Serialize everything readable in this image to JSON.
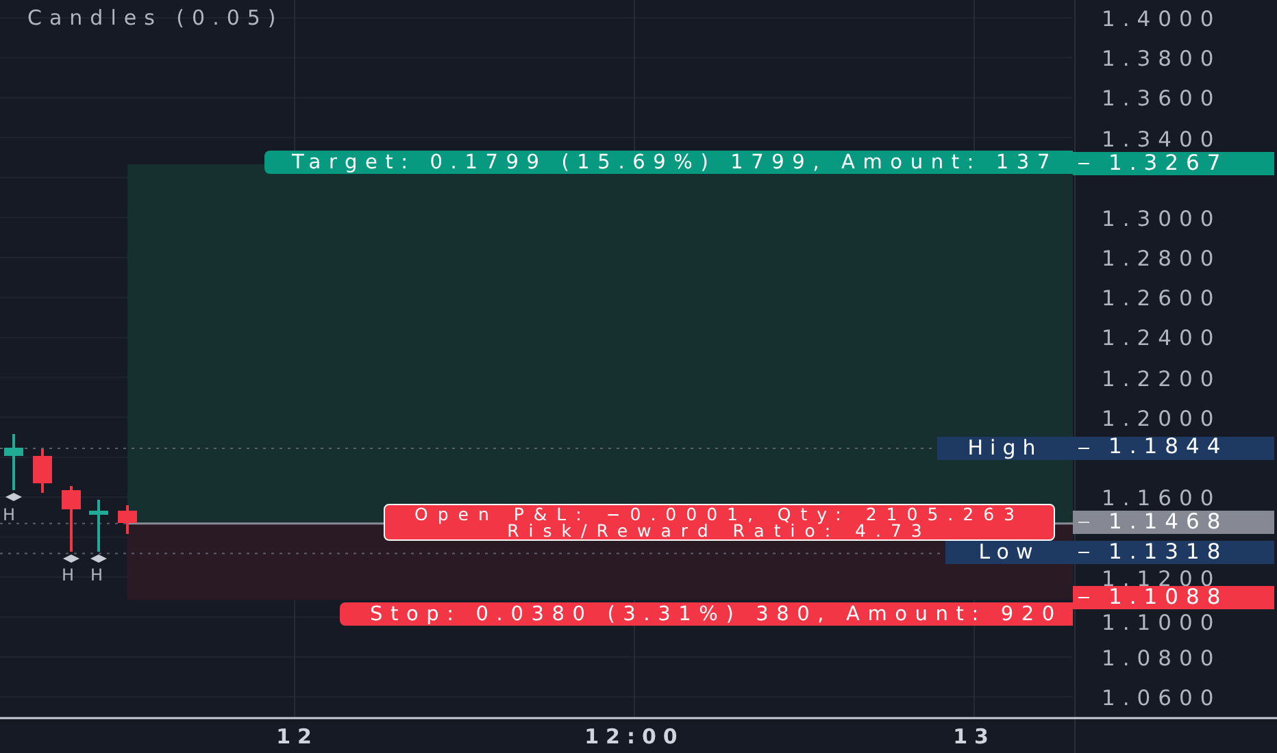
{
  "indicator_label": "Candles (0.05)",
  "pivot_labels": [
    {
      "text": "H"
    },
    {
      "text": "H"
    },
    {
      "text": "H"
    }
  ],
  "position": {
    "target_label": "Target: 0.1799 (15.69%) 1799, Amount: 137",
    "pnl_lines": [
      "Open P&L: −0.0001, Qty: 2105.263",
      "Risk/Reward Ratio: 4.73"
    ],
    "stop_label": "Stop: 0.0380 (3.31%) 380, Amount: 920"
  },
  "level_labels": [
    {
      "kind": "high",
      "text": "High"
    },
    {
      "kind": "low",
      "text": "Low"
    }
  ],
  "price_axis": {
    "ticks": [
      "1.4000",
      "1.3800",
      "1.3600",
      "1.3400",
      "1.3000",
      "1.2800",
      "1.2600",
      "1.2400",
      "1.2200",
      "1.2000",
      "1.1600",
      "1.1200",
      "1.1000",
      "1.0800",
      "1.0600"
    ],
    "tags": [
      {
        "kind": "target",
        "text": "1.3267"
      },
      {
        "kind": "high",
        "text": "1.1844"
      },
      {
        "kind": "current",
        "text": "1.1468"
      },
      {
        "kind": "low",
        "text": "1.1318"
      },
      {
        "kind": "stop",
        "text": "1.1088"
      }
    ]
  },
  "time_axis": [
    "12",
    "12:00",
    "13"
  ]
}
